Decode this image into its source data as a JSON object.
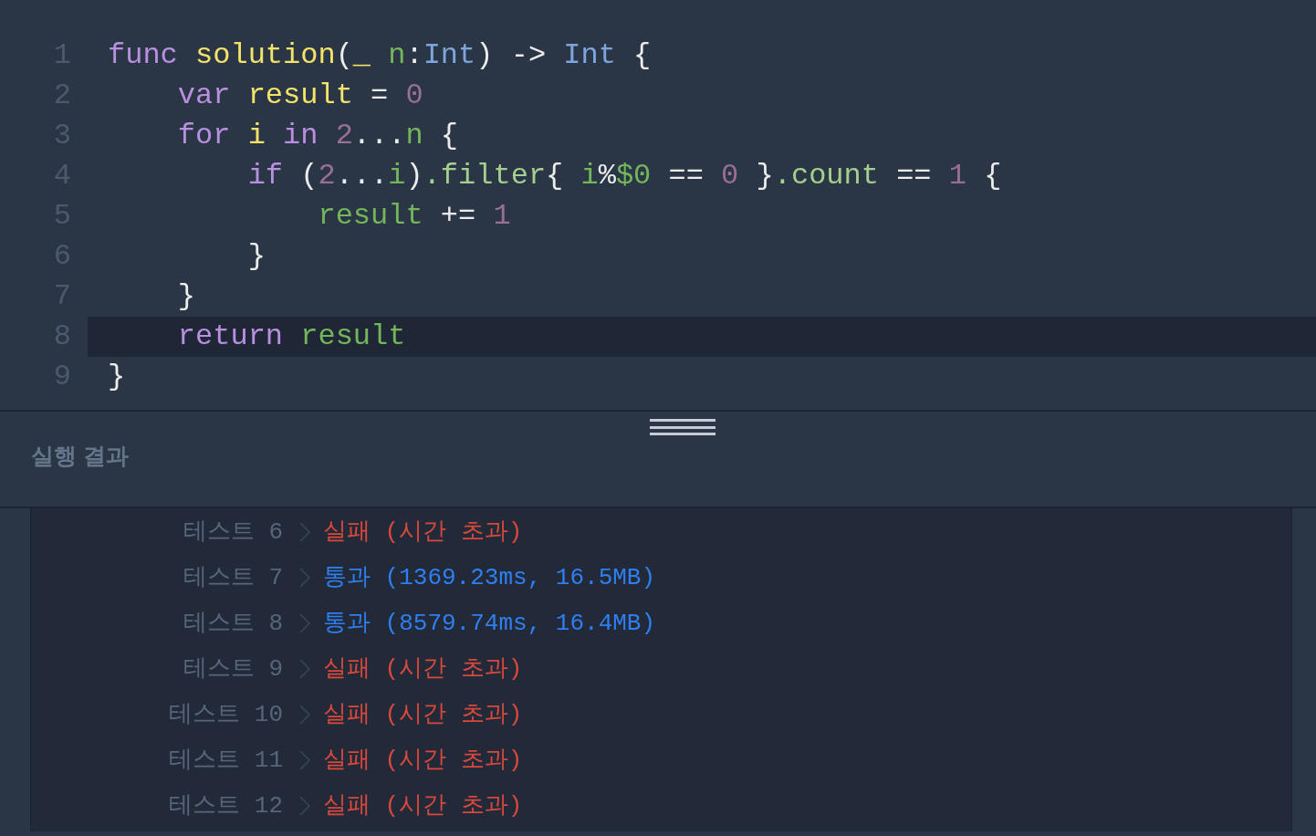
{
  "editor": {
    "lines": [
      {
        "number": "1",
        "current": false,
        "tokens": [
          {
            "text": "func ",
            "kind": "keyword"
          },
          {
            "text": "solution",
            "kind": "function"
          },
          {
            "text": "(",
            "kind": "plain"
          },
          {
            "text": "_ ",
            "kind": "function"
          },
          {
            "text": "n",
            "kind": "param"
          },
          {
            "text": ":",
            "kind": "plain"
          },
          {
            "text": "Int",
            "kind": "type"
          },
          {
            "text": ") -> ",
            "kind": "plain"
          },
          {
            "text": "Int",
            "kind": "type"
          },
          {
            "text": " {",
            "kind": "plain"
          }
        ]
      },
      {
        "number": "2",
        "current": false,
        "tokens": [
          {
            "text": "    var ",
            "kind": "keyword"
          },
          {
            "text": "result",
            "kind": "function"
          },
          {
            "text": " = ",
            "kind": "plain"
          },
          {
            "text": "0",
            "kind": "number"
          }
        ]
      },
      {
        "number": "3",
        "current": false,
        "tokens": [
          {
            "text": "    for ",
            "kind": "keyword"
          },
          {
            "text": "i ",
            "kind": "function"
          },
          {
            "text": "in ",
            "kind": "keyword"
          },
          {
            "text": "2",
            "kind": "number"
          },
          {
            "text": "...",
            "kind": "plain"
          },
          {
            "text": "n",
            "kind": "param"
          },
          {
            "text": " {",
            "kind": "plain"
          }
        ]
      },
      {
        "number": "4",
        "current": false,
        "tokens": [
          {
            "text": "        if",
            "kind": "keyword"
          },
          {
            "text": " (",
            "kind": "plain"
          },
          {
            "text": "2",
            "kind": "number"
          },
          {
            "text": "...",
            "kind": "plain"
          },
          {
            "text": "i",
            "kind": "param"
          },
          {
            "text": ")",
            "kind": "plain"
          },
          {
            "text": ".filter",
            "kind": "method"
          },
          {
            "text": "{ ",
            "kind": "plain"
          },
          {
            "text": "i",
            "kind": "param"
          },
          {
            "text": "%",
            "kind": "plain"
          },
          {
            "text": "$0",
            "kind": "param"
          },
          {
            "text": " == ",
            "kind": "plain"
          },
          {
            "text": "0",
            "kind": "number"
          },
          {
            "text": " }",
            "kind": "plain"
          },
          {
            "text": ".count",
            "kind": "method"
          },
          {
            "text": " == ",
            "kind": "plain"
          },
          {
            "text": "1",
            "kind": "number"
          },
          {
            "text": " {",
            "kind": "plain"
          }
        ]
      },
      {
        "number": "5",
        "current": false,
        "tokens": [
          {
            "text": "            result",
            "kind": "param"
          },
          {
            "text": " += ",
            "kind": "plain"
          },
          {
            "text": "1",
            "kind": "number"
          }
        ]
      },
      {
        "number": "6",
        "current": false,
        "tokens": [
          {
            "text": "        }",
            "kind": "plain"
          }
        ]
      },
      {
        "number": "7",
        "current": false,
        "tokens": [
          {
            "text": "    }",
            "kind": "plain"
          }
        ]
      },
      {
        "number": "8",
        "current": true,
        "tokens": [
          {
            "text": "    return ",
            "kind": "keyword"
          },
          {
            "text": "result",
            "kind": "param"
          }
        ]
      },
      {
        "number": "9",
        "current": false,
        "tokens": [
          {
            "text": "}",
            "kind": "plain"
          }
        ]
      }
    ]
  },
  "results": {
    "title": "실행 결과",
    "rows": [
      {
        "label": "테스트 6",
        "kind": "fail",
        "result": "실패 (시간 초과)"
      },
      {
        "label": "테스트 7",
        "kind": "pass",
        "result": "통과 (1369.23ms, 16.5MB)"
      },
      {
        "label": "테스트 8",
        "kind": "pass",
        "result": "통과 (8579.74ms, 16.4MB)"
      },
      {
        "label": "테스트 9",
        "kind": "fail",
        "result": "실패 (시간 초과)"
      },
      {
        "label": "테스트 10",
        "kind": "fail",
        "result": "실패 (시간 초과)"
      },
      {
        "label": "테스트 11",
        "kind": "fail",
        "result": "실패 (시간 초과)"
      },
      {
        "label": "테스트 12",
        "kind": "fail",
        "result": "실패 (시간 초과)"
      }
    ]
  }
}
